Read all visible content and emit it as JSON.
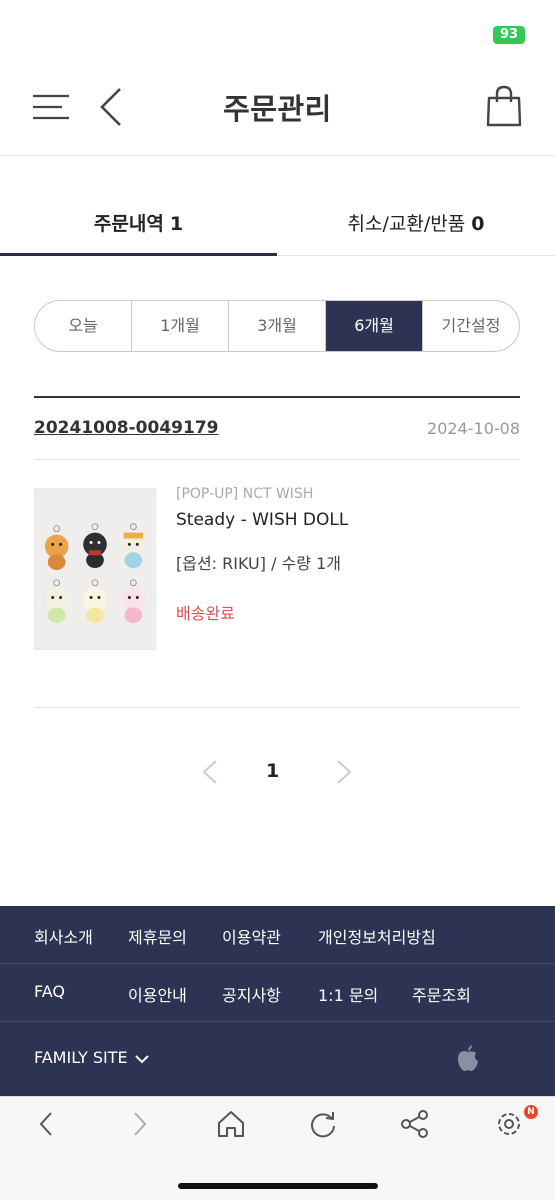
{
  "status_bar": {
    "battery": "93"
  },
  "header": {
    "title": "주문관리"
  },
  "tabs": [
    {
      "label": "주문내역",
      "count": "1"
    },
    {
      "label": "취소/교환/반품",
      "count": "0"
    }
  ],
  "period_filter": {
    "options": [
      "오늘",
      "1개월",
      "3개월",
      "6개월",
      "기간설정"
    ],
    "selected": "6개월"
  },
  "order": {
    "number": "20241008-0049179",
    "date": "2024-10-08",
    "item": {
      "brand": "[POP-UP] NCT WISH",
      "name": "Steady - WISH DOLL",
      "option": "[옵션: RIKU] / 수량 1개",
      "status": "배송완료"
    }
  },
  "pagination": {
    "current": "1"
  },
  "footer": {
    "row1": [
      "회사소개",
      "제휴문의",
      "이용약관",
      "개인정보처리방침"
    ],
    "row2": [
      "FAQ",
      "이용안내",
      "공지사항",
      "1:1 문의",
      "주문조회"
    ],
    "family_site": "FAMILY SITE"
  },
  "browser_bar": {
    "badge": "N"
  },
  "colors": {
    "accent": "#2d3453",
    "status": "#d9534f",
    "battery": "#34c759"
  },
  "icons": [
    "menu-icon",
    "back-icon",
    "shopping-bag-icon",
    "chevron-left-icon",
    "chevron-right-icon",
    "apple-icon",
    "home-icon",
    "refresh-icon",
    "share-icon",
    "settings-icon"
  ]
}
